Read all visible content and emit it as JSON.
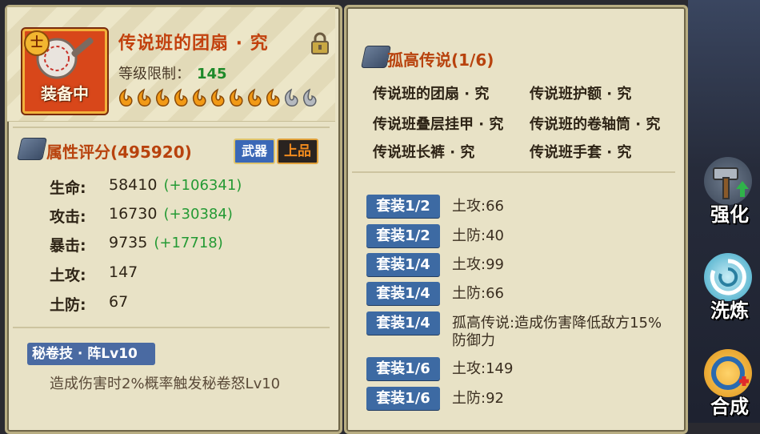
{
  "item": {
    "title": "传说班的团扇 · 究",
    "level_label": "等级限制：",
    "level_value": "145",
    "equip_badge": "装备中",
    "rank_badge": "士",
    "stars_filled": 9,
    "stars_total": 11
  },
  "score": {
    "title": "属性评分(495920)",
    "tag_type": "武器",
    "tag_quality": "上品"
  },
  "stats": [
    {
      "label": "生命:",
      "value": "58410",
      "bonus": "(+106341)"
    },
    {
      "label": "攻击:",
      "value": "16730",
      "bonus": "(+30384)"
    },
    {
      "label": "暴击:",
      "value": "9735",
      "bonus": "(+17718)"
    },
    {
      "label": "土攻:",
      "value": "147",
      "bonus": ""
    },
    {
      "label": "土防:",
      "value": "67",
      "bonus": ""
    }
  ],
  "skill": {
    "title": "秘卷技 · 阵Lv10",
    "desc": "造成伤害时2%概率触发秘卷怒Lv10"
  },
  "set": {
    "title": "孤高传说(1/6)",
    "pieces": [
      "传说班的团扇 · 究",
      "传说班护额 · 究",
      "传说班叠层挂甲 · 究",
      "传说班的卷轴筒 · 究",
      "传说班长裤 · 究",
      "传说班手套 · 究"
    ],
    "bonuses": [
      {
        "tag": "套装1/2",
        "text": "土攻:66"
      },
      {
        "tag": "套装1/2",
        "text": "土防:40"
      },
      {
        "tag": "套装1/4",
        "text": "土攻:99"
      },
      {
        "tag": "套装1/4",
        "text": "土防:66"
      },
      {
        "tag": "套装1/4",
        "text": "孤高传说:造成伤害降低敌方15%防御力"
      },
      {
        "tag": "套装1/6",
        "text": "土攻:149"
      },
      {
        "tag": "套装1/6",
        "text": "土防:92"
      }
    ]
  },
  "side_buttons": [
    {
      "label": "强化",
      "icon": "hammer-icon"
    },
    {
      "label": "洗炼",
      "icon": "swirl-icon"
    },
    {
      "label": "合成",
      "icon": "merge-icon"
    }
  ],
  "colors": {
    "panel_bg": "#e8e2c6",
    "title_orange": "#c2410e",
    "bonus_green": "#249a34",
    "tag_blue": "#3d6aa3"
  }
}
